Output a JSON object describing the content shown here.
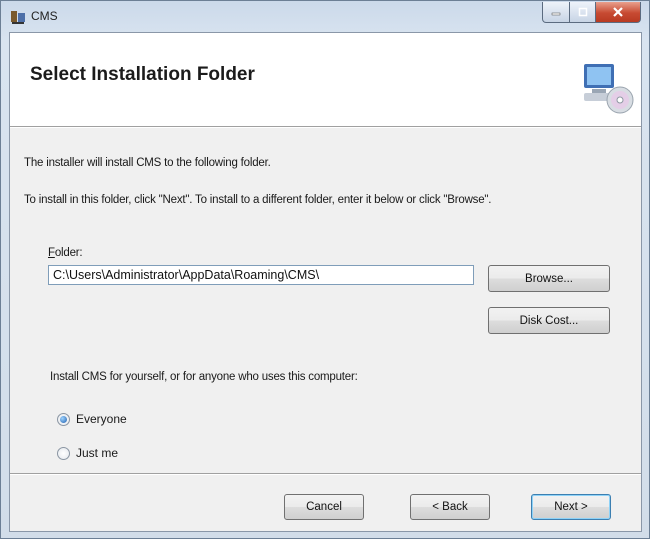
{
  "window": {
    "title": "CMS"
  },
  "banner": {
    "title": "Select Installation Folder"
  },
  "body": {
    "line1": "The installer will install CMS to the following folder.",
    "line2": "To install in this folder, click \"Next\". To install to a different folder, enter it below or click \"Browse\".",
    "folder_label": "Folder:",
    "folder_value": "C:\\Users\\Administrator\\AppData\\Roaming\\CMS\\",
    "browse_label": "Browse...",
    "disk_cost_label": "Disk Cost...",
    "scope_prompt": "Install CMS for yourself, or for anyone who uses this computer:",
    "options": [
      {
        "label": "Everyone",
        "selected": true
      },
      {
        "label": "Just me",
        "selected": false
      }
    ]
  },
  "footer": {
    "cancel_label": "Cancel",
    "back_label": "< Back",
    "next_label": "Next >"
  }
}
